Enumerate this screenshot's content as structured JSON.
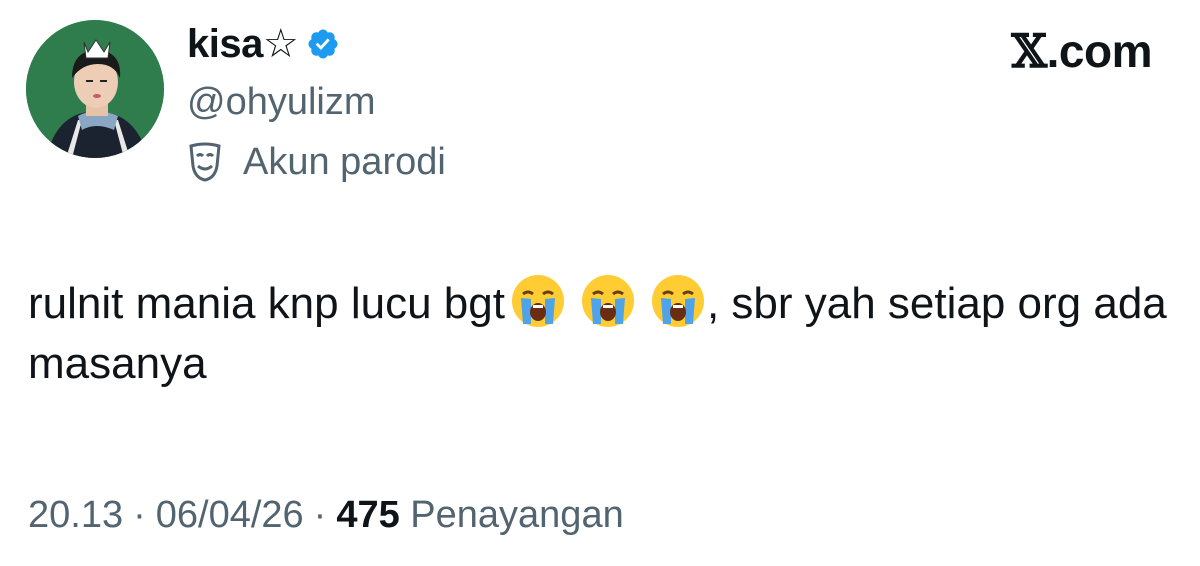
{
  "author": {
    "display_name": "kisa☆",
    "handle": "@ohyulizm",
    "verified": true,
    "label": "Akun parodi"
  },
  "brand": {
    "mark": "𝕏",
    "suffix": ".com"
  },
  "tweet": {
    "text_before_emoji": "rulnit mania knp lucu bgt",
    "emoji": [
      "loudly-crying-face",
      "loudly-crying-face",
      "loudly-crying-face"
    ],
    "text_after_emoji": ", sbr yah setiap org ada masanya"
  },
  "meta": {
    "time": "20.13",
    "date": "06/04/26",
    "separator": "·",
    "views_count": "475",
    "views_label": "Penayangan"
  },
  "colors": {
    "text_primary": "#0f1419",
    "text_secondary": "#536471",
    "verified_badge": "#1d9bf0",
    "avatar_bg": "#2e7a4a"
  }
}
